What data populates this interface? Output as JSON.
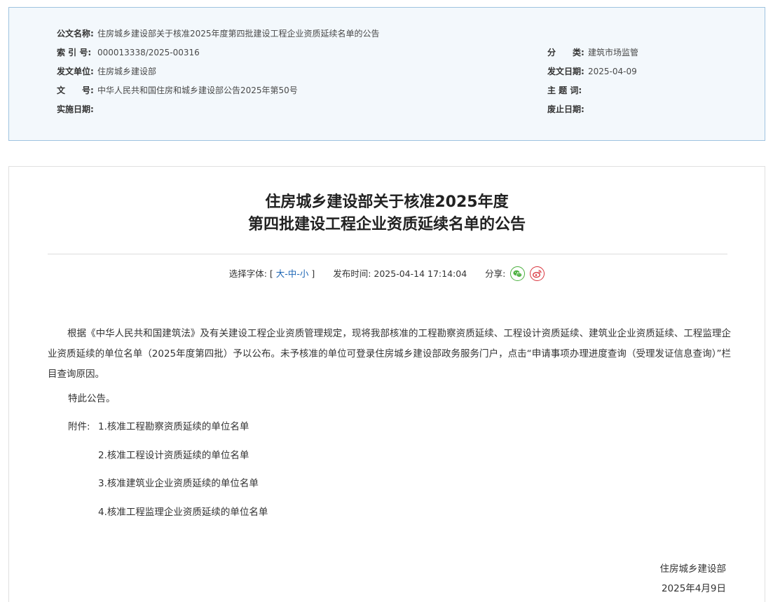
{
  "meta": {
    "doc_name_label": "公文名称:",
    "doc_name": "住房城乡建设部关于核准2025年度第四批建设工程企业资质延续名单的公告",
    "index_label": "索 引 号:",
    "index_no": "000013338/2025-00316",
    "category_label": "分　　类:",
    "category": "建筑市场监管",
    "issuer_label": "发文单位:",
    "issuer": "住房城乡建设部",
    "issue_date_label": "发文日期:",
    "issue_date": "2025-04-09",
    "doc_no_label": "文　　号:",
    "doc_no": "中华人民共和国住房和城乡建设部公告2025年第50号",
    "subject_label": "主 题 词:",
    "subject": "",
    "effective_label": "实施日期:",
    "effective": "",
    "expiry_label": "废止日期:",
    "expiry": ""
  },
  "article": {
    "title_line1": "住房城乡建设部关于核准2025年度",
    "title_line2": "第四批建设工程企业资质延续名单的公告",
    "font_select_label": "选择字体:",
    "bracket_open": "[",
    "font_large": "大",
    "font_medium": "中",
    "font_small": "小",
    "bracket_close": "]",
    "sep": "-",
    "publish_label": "发布时间:",
    "publish_time": "2025-04-14 17:14:04",
    "share_label": "分享:",
    "paragraph1": "根据《中华人民共和国建筑法》及有关建设工程企业资质管理规定，现将我部核准的工程勘察资质延续、工程设计资质延续、建筑业企业资质延续、工程监理企业资质延续的单位名单（2025年度第四批）予以公布。未予核准的单位可登录住房城乡建设部政务服务门户，点击“申请事项办理进度查询（受理发证信息查询）”栏目查询原因。",
    "notice": "特此公告。",
    "attachment_label": "附件:",
    "attachments": [
      "1.核准工程勘察资质延续的单位名单",
      "2.核准工程设计资质延续的单位名单",
      "3.核准建筑业企业资质延续的单位名单",
      "4.核准工程监理企业资质延续的单位名单"
    ],
    "signature": "住房城乡建设部",
    "sign_date": "2025年4月9日"
  },
  "colors": {
    "link_blue": "#1a64b4",
    "meta_border": "#9fc3e0",
    "meta_bg": "#f3f8fc",
    "wechat_green": "#4cb140",
    "weibo_red": "#d9343d"
  },
  "icons": [
    "wechat-icon",
    "weibo-icon"
  ]
}
